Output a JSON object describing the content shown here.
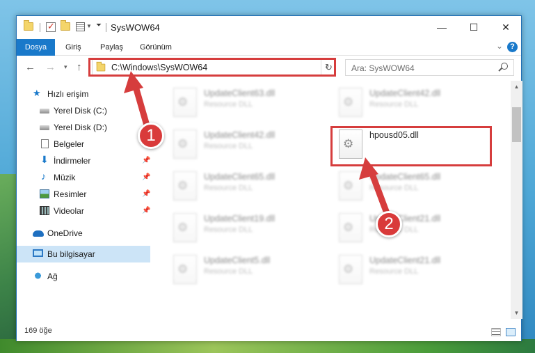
{
  "window": {
    "title": "SysWOW64",
    "minimize_glyph": "—",
    "maximize_glyph": "☐",
    "close_glyph": "✕"
  },
  "ribbon": {
    "tabs": [
      {
        "label": "Dosya",
        "active": true
      },
      {
        "label": "Giriş",
        "active": false
      },
      {
        "label": "Paylaş",
        "active": false
      },
      {
        "label": "Görünüm",
        "active": false
      }
    ],
    "help_glyph": "?"
  },
  "navigation": {
    "back_icon": "arrow-left-icon",
    "forward_icon": "arrow-right-icon",
    "up_icon": "arrow-up-icon",
    "address_path": "C:\\Windows\\SysWOW64",
    "search_placeholder": "Ara: SysWOW64"
  },
  "sidebar": {
    "items": [
      {
        "label": "Hızlı erişim",
        "icon": "star-icon"
      },
      {
        "label": "Yerel Disk (C:)",
        "icon": "disk-icon"
      },
      {
        "label": "Yerel Disk (D:)",
        "icon": "disk-icon"
      },
      {
        "label": "Belgeler",
        "icon": "document-icon",
        "pinned": true
      },
      {
        "label": "İndirmeler",
        "icon": "download-icon",
        "pinned": true
      },
      {
        "label": "Müzik",
        "icon": "music-icon",
        "pinned": true
      },
      {
        "label": "Resimler",
        "icon": "pictures-icon",
        "pinned": true
      },
      {
        "label": "Videolar",
        "icon": "videos-icon",
        "pinned": true
      },
      {
        "label": "OneDrive",
        "icon": "cloud-icon"
      },
      {
        "label": "Bu bilgisayar",
        "icon": "computer-icon",
        "selected": true
      },
      {
        "label": "Ağ",
        "icon": "network-icon"
      }
    ]
  },
  "files": [
    {
      "name": "UpdateClient63.dll",
      "type": "Resource DLL",
      "blurred": true
    },
    {
      "name": "UpdateClient42.dll",
      "type": "Resource DLL",
      "blurred": true
    },
    {
      "name": "UpdateClient42.dll",
      "type": "Resource DLL",
      "blurred": true
    },
    {
      "name": "hpousd05.dll",
      "type": "",
      "blurred": false,
      "highlighted": true
    },
    {
      "name": "UpdateClient65.dll",
      "type": "Resource DLL",
      "blurred": true
    },
    {
      "name": "UpdateClient65.dll",
      "type": "Resource DLL",
      "blurred": true
    },
    {
      "name": "UpdateClient19.dll",
      "type": "Resource DLL",
      "blurred": true
    },
    {
      "name": "UpdateClient21.dll",
      "type": "Resource DLL",
      "blurred": true
    },
    {
      "name": "UpdateClient5.dll",
      "type": "Resource DLL",
      "blurred": true
    },
    {
      "name": "UpdateClient21.dll",
      "type": "Resource DLL",
      "blurred": true
    }
  ],
  "statusbar": {
    "item_count": "169 öğe"
  },
  "annotations": {
    "step1": "1",
    "step2": "2",
    "color": "#d63d3d"
  }
}
